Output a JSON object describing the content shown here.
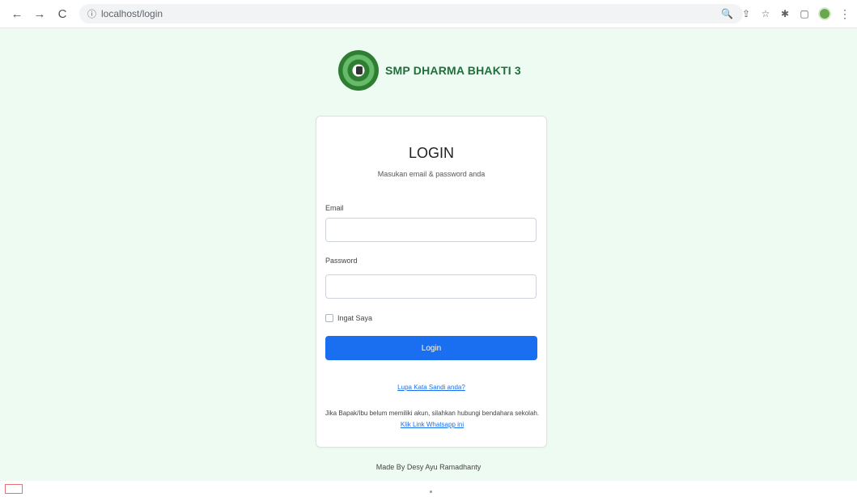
{
  "browser": {
    "url": "localhost/login",
    "nav": {
      "back": "←",
      "forward": "→",
      "reload": "C",
      "site_info": "ⓘ"
    },
    "tools": {
      "zoom": "🔍",
      "share": "⇪",
      "bookmark": "☆",
      "extensions": "✱",
      "tab": "▢",
      "menu": "⋮"
    }
  },
  "brand": {
    "name": "SMP DHARMA BHAKTI 3"
  },
  "login": {
    "title": "LOGIN",
    "subtitle": "Masukan email & password anda",
    "email_label": "Email",
    "email_value": "",
    "password_label": "Password",
    "password_value": "",
    "remember_label": "Ingat Saya",
    "submit_label": "Login",
    "forgot_link": "Lupa Kata Sandi anda?",
    "info_text": "Jika Bapak/Ibu belum memiliki akun, silahkan hubungi bendahara sekolah.",
    "info_link": "Klik Link Whatsapp ini"
  },
  "footer": {
    "text": "Made By Desy Ayu Ramadhanty"
  }
}
